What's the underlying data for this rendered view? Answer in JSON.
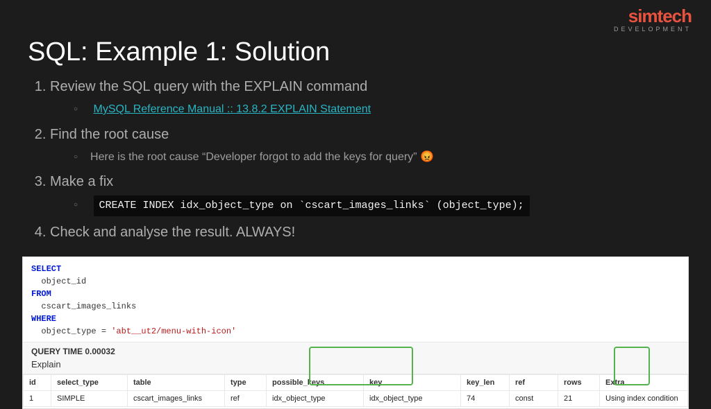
{
  "logo": {
    "main": "simtech",
    "sub": "DEVELOPMENT"
  },
  "title": "SQL: Example 1: Solution",
  "items": {
    "0": {
      "text": "Review the SQL query with the EXPLAIN command",
      "sub": {
        "0": {
          "link": "MySQL Reference Manual :: 13.8.2 EXPLAIN Statement"
        }
      }
    },
    "1": {
      "text": "Find the root cause",
      "sub": {
        "0": {
          "text": "Here is the root cause “Developer forgot to add the keys for query” 😡"
        }
      }
    },
    "2": {
      "text": "Make a fix",
      "sub": {
        "0": {
          "code": "CREATE INDEX idx_object_type on `cscart_images_links` (object_type);"
        }
      }
    },
    "3": {
      "text": "Check and analyse the result. ALWAYS!"
    }
  },
  "result": {
    "sql": {
      "select_kw": "SELECT",
      "select_cols": "  object_id",
      "from_kw": "FROM",
      "from_tbl": "  cscart_images_links",
      "where_kw": "WHERE",
      "where_expr_col": "  object_type = ",
      "where_expr_val": "'abt__ut2/menu-with-icon'"
    },
    "query_time_label": "QUERY TIME",
    "query_time_value": "0.00032",
    "explain_label": "Explain",
    "cols": {
      "id": "id",
      "select_type": "select_type",
      "table": "table",
      "type": "type",
      "possible_keys": "possible_keys",
      "key": "key",
      "key_len": "key_len",
      "ref": "ref",
      "rows": "rows",
      "extra": "Extra"
    },
    "row": {
      "id": "1",
      "select_type": "SIMPLE",
      "table": "cscart_images_links",
      "type": "ref",
      "possible_keys": "idx_object_type",
      "key": "idx_object_type",
      "key_len": "74",
      "ref": "const",
      "rows": "21",
      "extra": "Using index condition"
    }
  }
}
